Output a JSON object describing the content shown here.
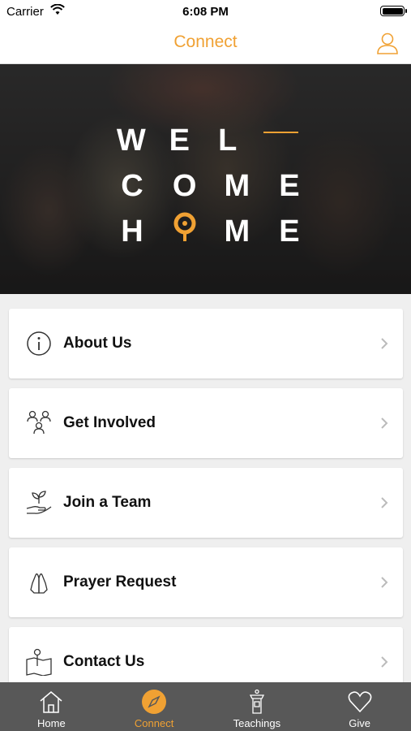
{
  "status": {
    "carrier": "Carrier",
    "time": "6:08 PM"
  },
  "nav": {
    "title": "Connect"
  },
  "hero": {
    "row1": [
      "W",
      "E",
      "L"
    ],
    "row2": [
      "C",
      "O",
      "M",
      "E"
    ],
    "row3": [
      "H",
      "M",
      "E"
    ]
  },
  "menu": [
    {
      "label": "About Us",
      "icon": "info-icon"
    },
    {
      "label": "Get Involved",
      "icon": "people-icon"
    },
    {
      "label": "Join a Team",
      "icon": "plant-hand-icon"
    },
    {
      "label": "Prayer Request",
      "icon": "praying-hands-icon"
    },
    {
      "label": "Contact Us",
      "icon": "map-pin-icon"
    }
  ],
  "tabs": [
    {
      "label": "Home",
      "icon": "home-icon"
    },
    {
      "label": "Connect",
      "icon": "compass-icon",
      "active": true
    },
    {
      "label": "Teachings",
      "icon": "podium-icon"
    },
    {
      "label": "Give",
      "icon": "heart-icon"
    }
  ],
  "colors": {
    "accent": "#f0a133",
    "tabbar": "#585858"
  }
}
